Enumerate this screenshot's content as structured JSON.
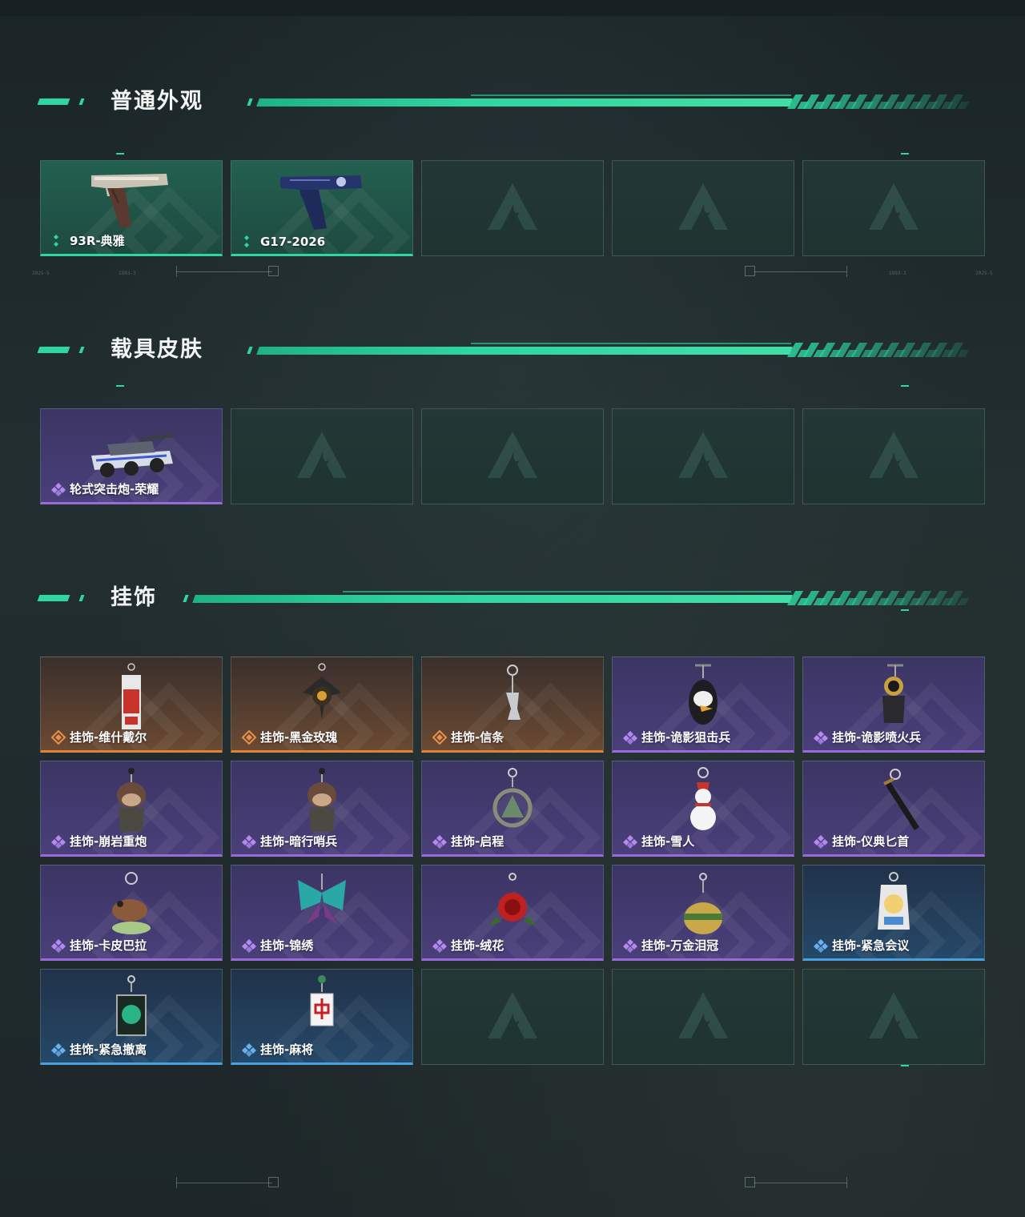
{
  "sections": [
    {
      "title": "普通外观",
      "items": [
        {
          "label": "93R-典雅",
          "rarity": "green",
          "icon": "pistol-silver-icon"
        },
        {
          "label": "G17-2026",
          "rarity": "green",
          "icon": "pistol-blue-icon"
        },
        {
          "label": "",
          "rarity": "empty"
        },
        {
          "label": "",
          "rarity": "empty"
        },
        {
          "label": "",
          "rarity": "empty"
        }
      ]
    },
    {
      "title": "载具皮肤",
      "items": [
        {
          "label": "轮式突击炮-荣耀",
          "rarity": "purple",
          "icon": "armored-vehicle-icon"
        },
        {
          "label": "",
          "rarity": "empty"
        },
        {
          "label": "",
          "rarity": "empty"
        },
        {
          "label": "",
          "rarity": "empty"
        },
        {
          "label": "",
          "rarity": "empty"
        }
      ]
    },
    {
      "title": "挂饰",
      "items": [
        {
          "label": "挂饰-维什戴尔",
          "rarity": "orange",
          "icon": "charm-tag-icon"
        },
        {
          "label": "挂饰-黑金玫瑰",
          "rarity": "orange",
          "icon": "charm-rose-icon"
        },
        {
          "label": "挂饰-信条",
          "rarity": "orange",
          "icon": "charm-figure-icon"
        },
        {
          "label": "挂饰-诡影狙击兵",
          "rarity": "purple",
          "icon": "charm-bird-icon"
        },
        {
          "label": "挂饰-诡影喷火兵",
          "rarity": "purple",
          "icon": "charm-soldier-icon"
        },
        {
          "label": "挂饰-崩岩重炮",
          "rarity": "purple",
          "icon": "charm-doll-icon"
        },
        {
          "label": "挂饰-暗行哨兵",
          "rarity": "purple",
          "icon": "charm-doll-icon"
        },
        {
          "label": "挂饰-启程",
          "rarity": "purple",
          "icon": "charm-ring-icon"
        },
        {
          "label": "挂饰-雪人",
          "rarity": "purple",
          "icon": "charm-snowman-icon"
        },
        {
          "label": "挂饰-仪典匕首",
          "rarity": "purple",
          "icon": "charm-dagger-icon"
        },
        {
          "label": "挂饰-卡皮巴拉",
          "rarity": "purple",
          "icon": "charm-capybara-icon"
        },
        {
          "label": "挂饰-锦绣",
          "rarity": "purple",
          "icon": "charm-butterfly-icon"
        },
        {
          "label": "挂饰-绒花",
          "rarity": "purple",
          "icon": "charm-flower-icon"
        },
        {
          "label": "挂饰-万金泪冠",
          "rarity": "purple",
          "icon": "charm-crown-icon"
        },
        {
          "label": "挂饰-紧急会议",
          "rarity": "blue",
          "icon": "charm-badge-icon"
        },
        {
          "label": "挂饰-紧急撤离",
          "rarity": "blue",
          "icon": "charm-box-icon"
        },
        {
          "label": "挂饰-麻将",
          "rarity": "blue",
          "icon": "charm-mahjong-icon"
        },
        {
          "label": "",
          "rarity": "empty"
        },
        {
          "label": "",
          "rarity": "empty"
        },
        {
          "label": "",
          "rarity": "empty"
        }
      ]
    }
  ],
  "colors": {
    "accent": "#2ed6a0",
    "green": "#2ed6a0",
    "purple": "#9a6bd8",
    "orange": "#e0823a",
    "blue": "#4aa0e0"
  },
  "ruler_labels": [
    "2025-5",
    "1993-3",
    "1993-3",
    "2025-5"
  ]
}
